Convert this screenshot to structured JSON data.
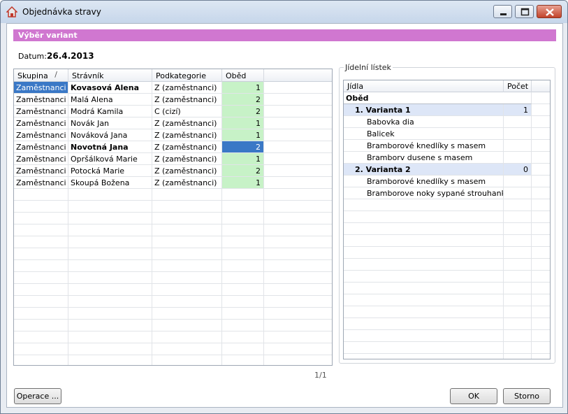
{
  "window": {
    "title": "Objednávka stravy"
  },
  "header": {
    "pink_label": "Výběr variant",
    "pink_color": "#d077d0"
  },
  "datum": {
    "label": "Datum:",
    "value": "26.4.2013"
  },
  "grid": {
    "columns": [
      "Skupina",
      "Strávník",
      "Podkategorie",
      "Oběd"
    ],
    "sort_mark": "/",
    "rows": [
      {
        "skupina": "Zaměstnanci",
        "stravnik": "Kovasová Alena",
        "podkategorie": "Z (zaměstnanci)",
        "obed": "1"
      },
      {
        "skupina": "Zaměstnanci",
        "stravnik": "Malá Alena",
        "podkategorie": "Z (zaměstnanci)",
        "obed": "2"
      },
      {
        "skupina": "Zaměstnanci",
        "stravnik": "Modrá Kamila",
        "podkategorie": "C (cizí)",
        "obed": "2"
      },
      {
        "skupina": "Zaměstnanci",
        "stravnik": "Novák Jan",
        "podkategorie": "Z (zaměstnanci)",
        "obed": "1"
      },
      {
        "skupina": "Zaměstnanci",
        "stravnik": "Nováková Jana",
        "podkategorie": "Z (zaměstnanci)",
        "obed": "1"
      },
      {
        "skupina": "Zaměstnanci",
        "stravnik": "Novotná Jana",
        "podkategorie": "Z (zaměstnanci)",
        "obed": "2"
      },
      {
        "skupina": "Zaměstnanci",
        "stravnik": "Opršálková Marie",
        "podkategorie": "Z (zaměstnanci)",
        "obed": "1"
      },
      {
        "skupina": "Zaměstnanci",
        "stravnik": "Potocká Marie",
        "podkategorie": "Z (zaměstnanci)",
        "obed": "2"
      },
      {
        "skupina": "Zaměstnanci",
        "stravnik": "Skoupá Božena",
        "podkategorie": "Z (zaměstnanci)",
        "obed": "1"
      }
    ],
    "highlight_green": "#c7f2c7",
    "selection_blue": "#3a78c6"
  },
  "pager": "1/1",
  "menu": {
    "group_label": "Jídelní lístek",
    "columns": [
      "Jídla",
      "Počet"
    ],
    "rows": [
      {
        "label": "Oběd",
        "count": "",
        "kind": "category"
      },
      {
        "label": "1. Varianta 1",
        "count": "1",
        "kind": "variant"
      },
      {
        "label": "Babovka dia",
        "count": "",
        "kind": "item"
      },
      {
        "label": "Balicek",
        "count": "",
        "kind": "item"
      },
      {
        "label": "Bramborové knedlíky s masem",
        "count": "",
        "kind": "item"
      },
      {
        "label": "Bramborv dusene s masem",
        "count": "",
        "kind": "item"
      },
      {
        "label": "2. Varianta 2",
        "count": "0",
        "kind": "variant"
      },
      {
        "label": "Bramborové knedlíky s masem",
        "count": "",
        "kind": "item"
      },
      {
        "label": "Bramborove noky sypané strouhankou...",
        "count": "",
        "kind": "item"
      }
    ]
  },
  "buttons": {
    "operace": "Operace ...",
    "ok": "OK",
    "storno": "Storno"
  }
}
